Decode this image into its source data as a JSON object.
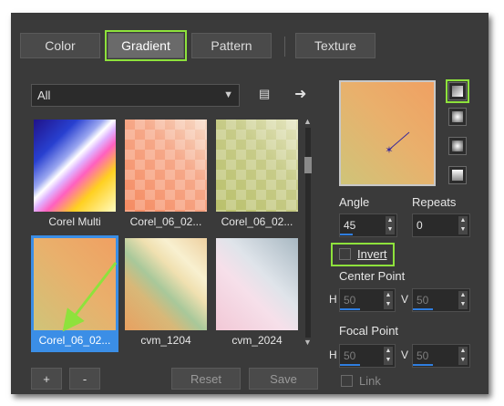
{
  "tabs": [
    {
      "label": "Color"
    },
    {
      "label": "Gradient"
    },
    {
      "label": "Pattern"
    },
    {
      "label": "Texture"
    }
  ],
  "filter": {
    "selected": "All"
  },
  "gradients": [
    {
      "label": "Corel Multi"
    },
    {
      "label": "Corel_06_02..."
    },
    {
      "label": "Corel_06_02..."
    },
    {
      "label": "Corel_06_02..."
    },
    {
      "label": "cvm_1204"
    },
    {
      "label": "cvm_2024"
    }
  ],
  "buttons": {
    "add": "+",
    "remove": "-",
    "reset": "Reset",
    "save": "Save"
  },
  "controls": {
    "angle_label": "Angle",
    "angle_value": "45",
    "repeats_label": "Repeats",
    "repeats_value": "0",
    "invert_label": "Invert",
    "center_label": "Center Point",
    "center_h": "50",
    "center_v": "50",
    "focal_label": "Focal Point",
    "focal_h": "50",
    "focal_v": "50",
    "h_label": "H",
    "v_label": "V",
    "link_label": "Link"
  },
  "colors": {
    "accent": "#3b8ee6",
    "highlight": "#8ee23c",
    "panel": "#3a3a3a"
  }
}
